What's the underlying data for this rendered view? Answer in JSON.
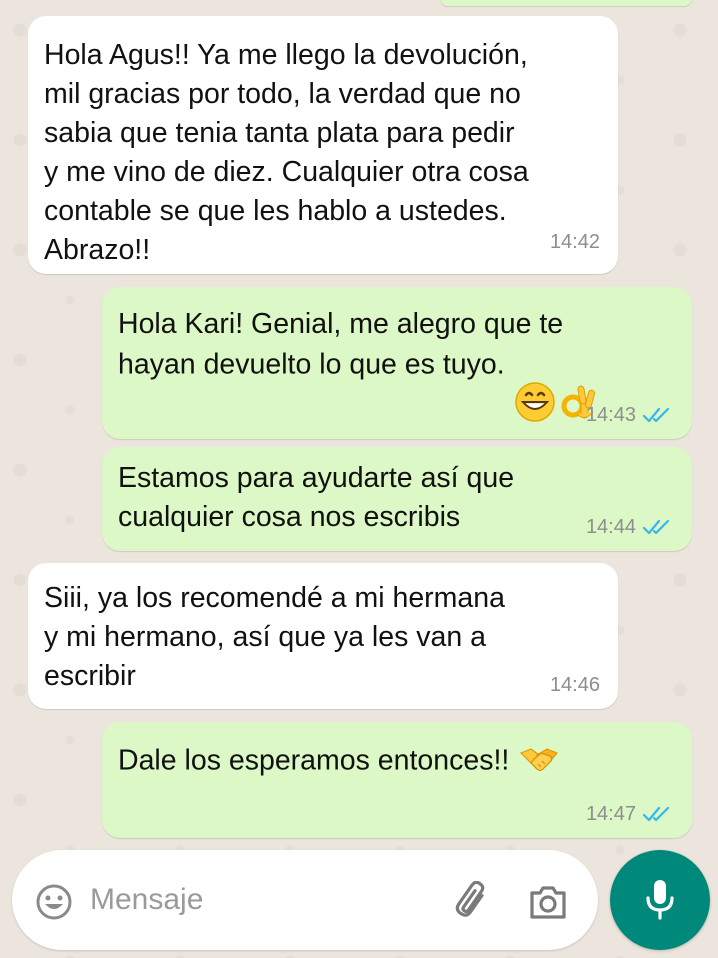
{
  "chat": {
    "messages": [
      {
        "direction": "incoming",
        "text": "Hola Agus!! Ya me llego la devolución,\nmil gracias por todo, la verdad que no\nsabia que tenia tanta plata para pedir\ny me vino de diez. Cualquier otra cosa\ncontable se que les hablo a ustedes.\nAbrazo!!",
        "time": "14:42"
      },
      {
        "direction": "outgoing",
        "text": "Hola Kari! Genial, me alegro que te\nhayan devuelto lo que es tuyo.",
        "emojis": [
          "grinning-face-emoji",
          "ok-hand-emoji"
        ],
        "time": "14:43",
        "status": "read"
      },
      {
        "direction": "outgoing",
        "text": "Estamos para ayudarte así que\ncualquier cosa nos escribis",
        "time": "14:44",
        "status": "read"
      },
      {
        "direction": "incoming",
        "text": "Siii, ya los recomendé a mi hermana\ny mi hermano, así que ya les van a\nescribir",
        "time": "14:46"
      },
      {
        "direction": "outgoing",
        "text": "Dale los esperamos entonces!!",
        "emojis": [
          "handshake-emoji"
        ],
        "time": "14:47",
        "status": "read"
      }
    ]
  },
  "composer": {
    "placeholder": "Mensaje",
    "icons": [
      "emoji-icon",
      "attach-icon",
      "camera-icon",
      "mic-icon"
    ]
  },
  "colors": {
    "incoming_bubble": "#ffffff",
    "outgoing_bubble": "#dcf8c6",
    "read_ticks": "#34b7f1",
    "mic_button": "#00897b",
    "wallpaper": "#ece5dd"
  }
}
